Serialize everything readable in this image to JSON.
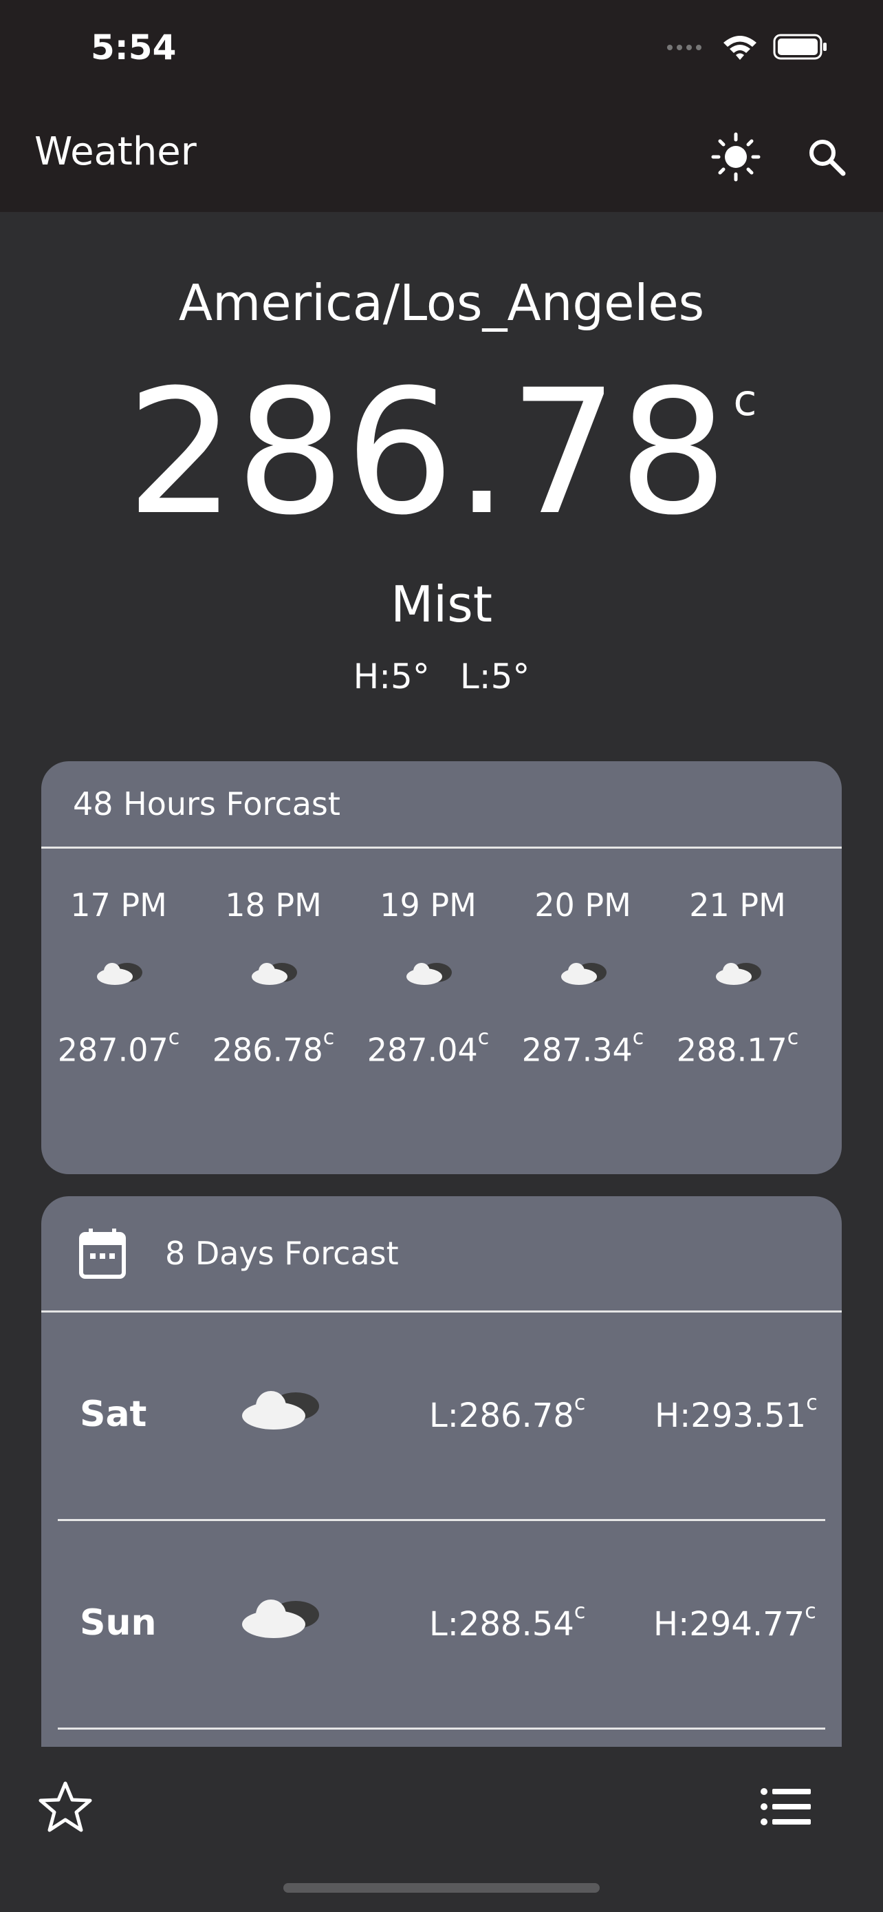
{
  "status_bar": {
    "time": "5:54"
  },
  "app_bar": {
    "title": "Weather",
    "theme_icon": "sun-icon",
    "search_icon": "search-icon"
  },
  "current": {
    "city": "America/Los_Angeles",
    "temperature": "286.78",
    "unit": "c",
    "condition": "Mist",
    "high": "H:5°",
    "low": "L:5°"
  },
  "hourly": {
    "title": "48 Hours Forcast",
    "items": [
      {
        "time": "17 PM",
        "temp": "287.07",
        "unit": "c",
        "icon": "cloud-icon"
      },
      {
        "time": "18 PM",
        "temp": "286.78",
        "unit": "c",
        "icon": "cloud-icon"
      },
      {
        "time": "19 PM",
        "temp": "287.04",
        "unit": "c",
        "icon": "cloud-icon"
      },
      {
        "time": "20 PM",
        "temp": "287.34",
        "unit": "c",
        "icon": "cloud-icon"
      },
      {
        "time": "21 PM",
        "temp": "288.17",
        "unit": "c",
        "icon": "cloud-icon"
      }
    ]
  },
  "daily": {
    "title": "8 Days Forcast",
    "icon": "calendar-icon",
    "items": [
      {
        "day": "Sat",
        "low": "L:286.78",
        "high": "H:293.51",
        "unit": "c",
        "icon": "cloud-icon"
      },
      {
        "day": "Sun",
        "low": "L:288.54",
        "high": "H:294.77",
        "unit": "c",
        "icon": "cloud-icon"
      }
    ]
  },
  "bottom_bar": {
    "left_icon": "star-icon",
    "right_icon": "list-icon"
  },
  "colors": {
    "background": "#2e2e30",
    "bar": "#231f20",
    "card": "#696c79"
  }
}
